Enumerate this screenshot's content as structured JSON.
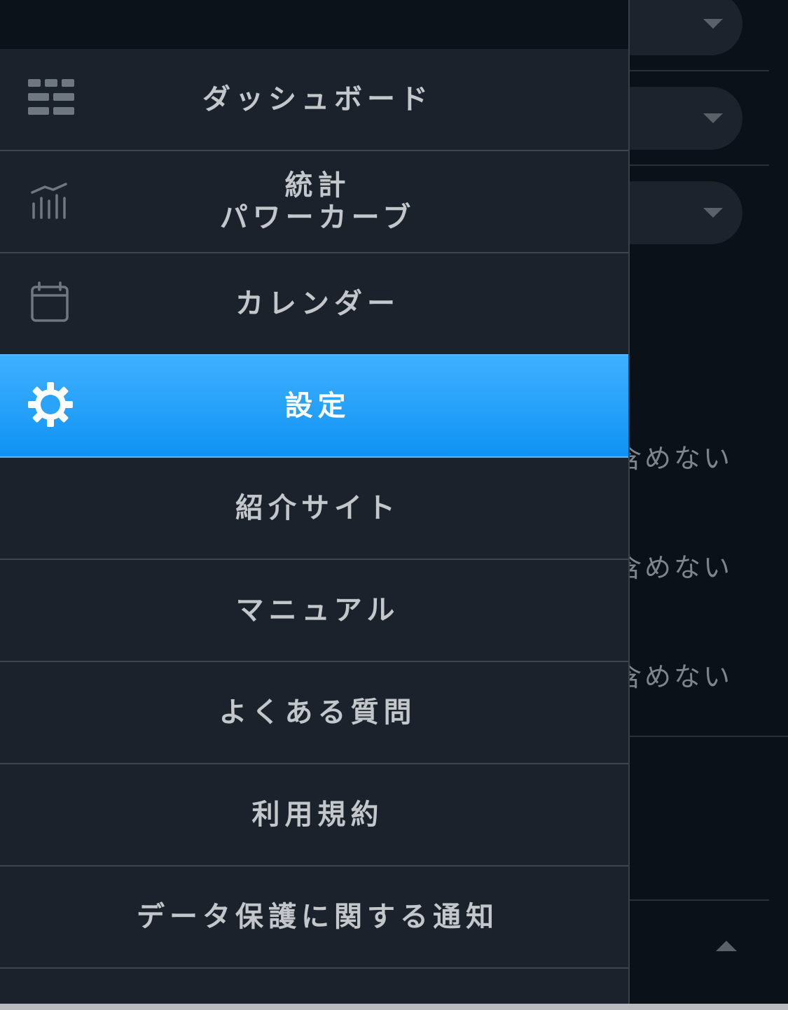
{
  "background": {
    "option_rows": [
      {
        "text": "含めない"
      },
      {
        "text": "含めない"
      },
      {
        "text": "含めない"
      }
    ]
  },
  "menu": {
    "items": [
      {
        "label": "ダッシュボード",
        "icon": "dashboard-grid-icon",
        "active": false
      },
      {
        "label_line1": "統計",
        "label_line2": "パワーカーブ",
        "icon": "bar-chart-icon",
        "active": false
      },
      {
        "label": "カレンダー",
        "icon": "calendar-icon",
        "active": false
      },
      {
        "label": "設定",
        "icon": "gear-icon",
        "active": true
      },
      {
        "label": "紹介サイト",
        "icon": "",
        "active": false
      },
      {
        "label": "マニュアル",
        "icon": "",
        "active": false
      },
      {
        "label": "よくある質問",
        "icon": "",
        "active": false
      },
      {
        "label": "利用規約",
        "icon": "",
        "active": false
      },
      {
        "label": "データ保護に関する通知",
        "icon": "",
        "active": false
      }
    ]
  },
  "colors": {
    "drawer_bg": "#1b222b",
    "active_accent": "#1e9cf8",
    "text": "#c3c6ca",
    "page_bg": "#0b1118"
  }
}
